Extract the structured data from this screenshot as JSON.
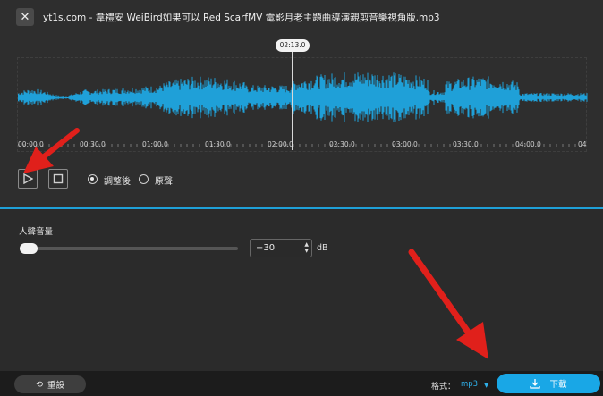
{
  "window": {
    "title": "yt1s.com - 韋禮安 WeiBird如果可以 Red ScarfMV 電影月老主題曲導演親剪音樂視角版.mp3",
    "close_glyph": "✕"
  },
  "waveform": {
    "playhead_time": "02:13.0",
    "playhead_progress": 0.487,
    "ticks": [
      "00:00.0",
      "00:30.0",
      "01:00.0",
      "01:30.0",
      "02:00.0",
      "02:30.0",
      "03:00.0",
      "03:30.0",
      "04:00.0",
      "04"
    ],
    "wave_color": "#1fa0d8"
  },
  "controls": {
    "play_icon": "play-icon",
    "stop_icon": "stop-icon",
    "options": [
      {
        "label": "調整後",
        "selected": true
      },
      {
        "label": "原聲",
        "selected": false
      }
    ]
  },
  "vocal": {
    "title": "人聲音量",
    "slider_level": 0.0,
    "value": "−30",
    "unit": "dB"
  },
  "footer": {
    "reset_label": "重設",
    "format_label": "格式：",
    "format_value": "mp3",
    "download_label": "下載"
  },
  "colors": {
    "accent": "#19a7e6",
    "annotation_arrow": "#e0201b"
  }
}
